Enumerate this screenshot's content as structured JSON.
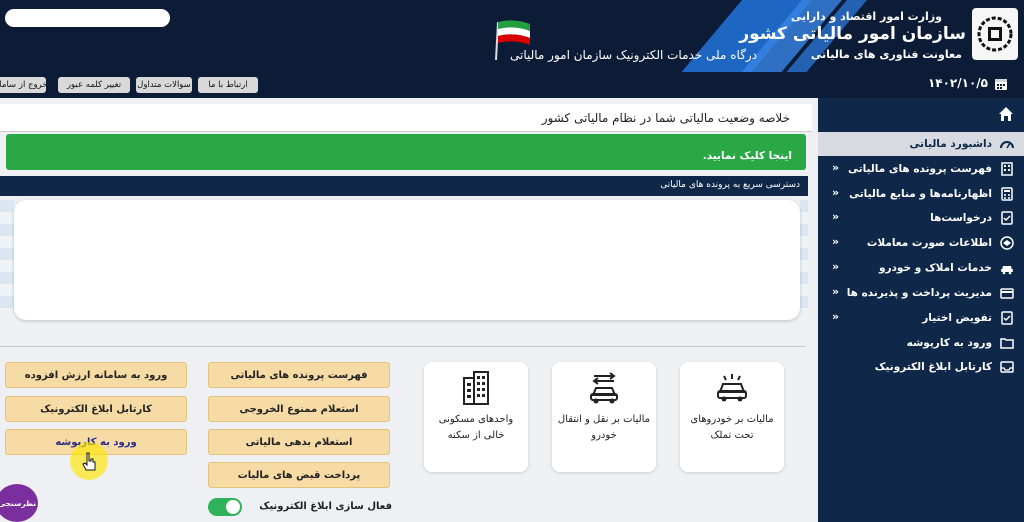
{
  "header": {
    "ministry": "وزارت امور اقتصاد و دارایی",
    "org_name": "سازمان امور مالیاتی کشور",
    "deputy": "معاونت فناوری های مالیاتی",
    "portal_title": "درگاه ملی خدمات الکترونیک سازمان امور مالیاتی"
  },
  "toolbar": {
    "logout": "خروج از سامانه",
    "change_password": "تغییر کلمه عبور",
    "faq": "سوالات متداول",
    "contact": "ارتباط با ما",
    "date": "۱۴۰۲/۱۰/۵"
  },
  "sidebar": {
    "items": [
      {
        "label": "داشبورد مالیاتی",
        "icon": "dashboard-icon",
        "active": true
      },
      {
        "label": "فهرست پرونده های مالیاتی",
        "icon": "building-icon"
      },
      {
        "label": "اظهارنامه‌ها و منابع مالیاتی",
        "icon": "calculator-icon"
      },
      {
        "label": "درخواست‌ها",
        "icon": "checklist-icon"
      },
      {
        "label": "اطلاعات صورت معاملات",
        "icon": "handshake-icon"
      },
      {
        "label": "خدمات املاک و خودرو",
        "icon": "car-icon"
      },
      {
        "label": "مدیریت پرداخت و پذیرنده ها",
        "icon": "card-icon"
      },
      {
        "label": "تفویض اختیار",
        "icon": "checklist-icon"
      },
      {
        "label": "ورود به کارپوشه",
        "icon": "folder-icon"
      },
      {
        "label": "کارتابل ابلاغ الکترونیک",
        "icon": "inbox-icon"
      }
    ]
  },
  "main": {
    "title": "خلاصه وضعیت مالیاتی شما در نظام مالیاتی کشور",
    "notice_click": "اینجا کلیک نمایید.",
    "quick_access": "دسترسی سریع به پرونده های مالیاتی"
  },
  "tiles": [
    {
      "label": "مالیات بر خودروهای تحت تملک",
      "icon": "car-tax-icon"
    },
    {
      "label": "مالیات بر نقل و انتقال خودرو",
      "icon": "car-transfer-icon"
    },
    {
      "label": "واحدهای مسکونی خالی از سکنه",
      "icon": "apartment-icon"
    }
  ],
  "actions_mid": [
    "فهرست پرونده های مالیاتی",
    "استعلام ممنوع الخروجی",
    "استعلام بدهی مالیاتی",
    "پرداخت قبض های مالیات"
  ],
  "actions_left": [
    "ورود به سامانه ارزش افزوده",
    "کارتابل ابلاغ الکترونیک",
    "ورود به کارپوشه"
  ],
  "toggle_label": "فعال سازی ابلاغ الکترونیک",
  "survey": "نظرسنجی"
}
